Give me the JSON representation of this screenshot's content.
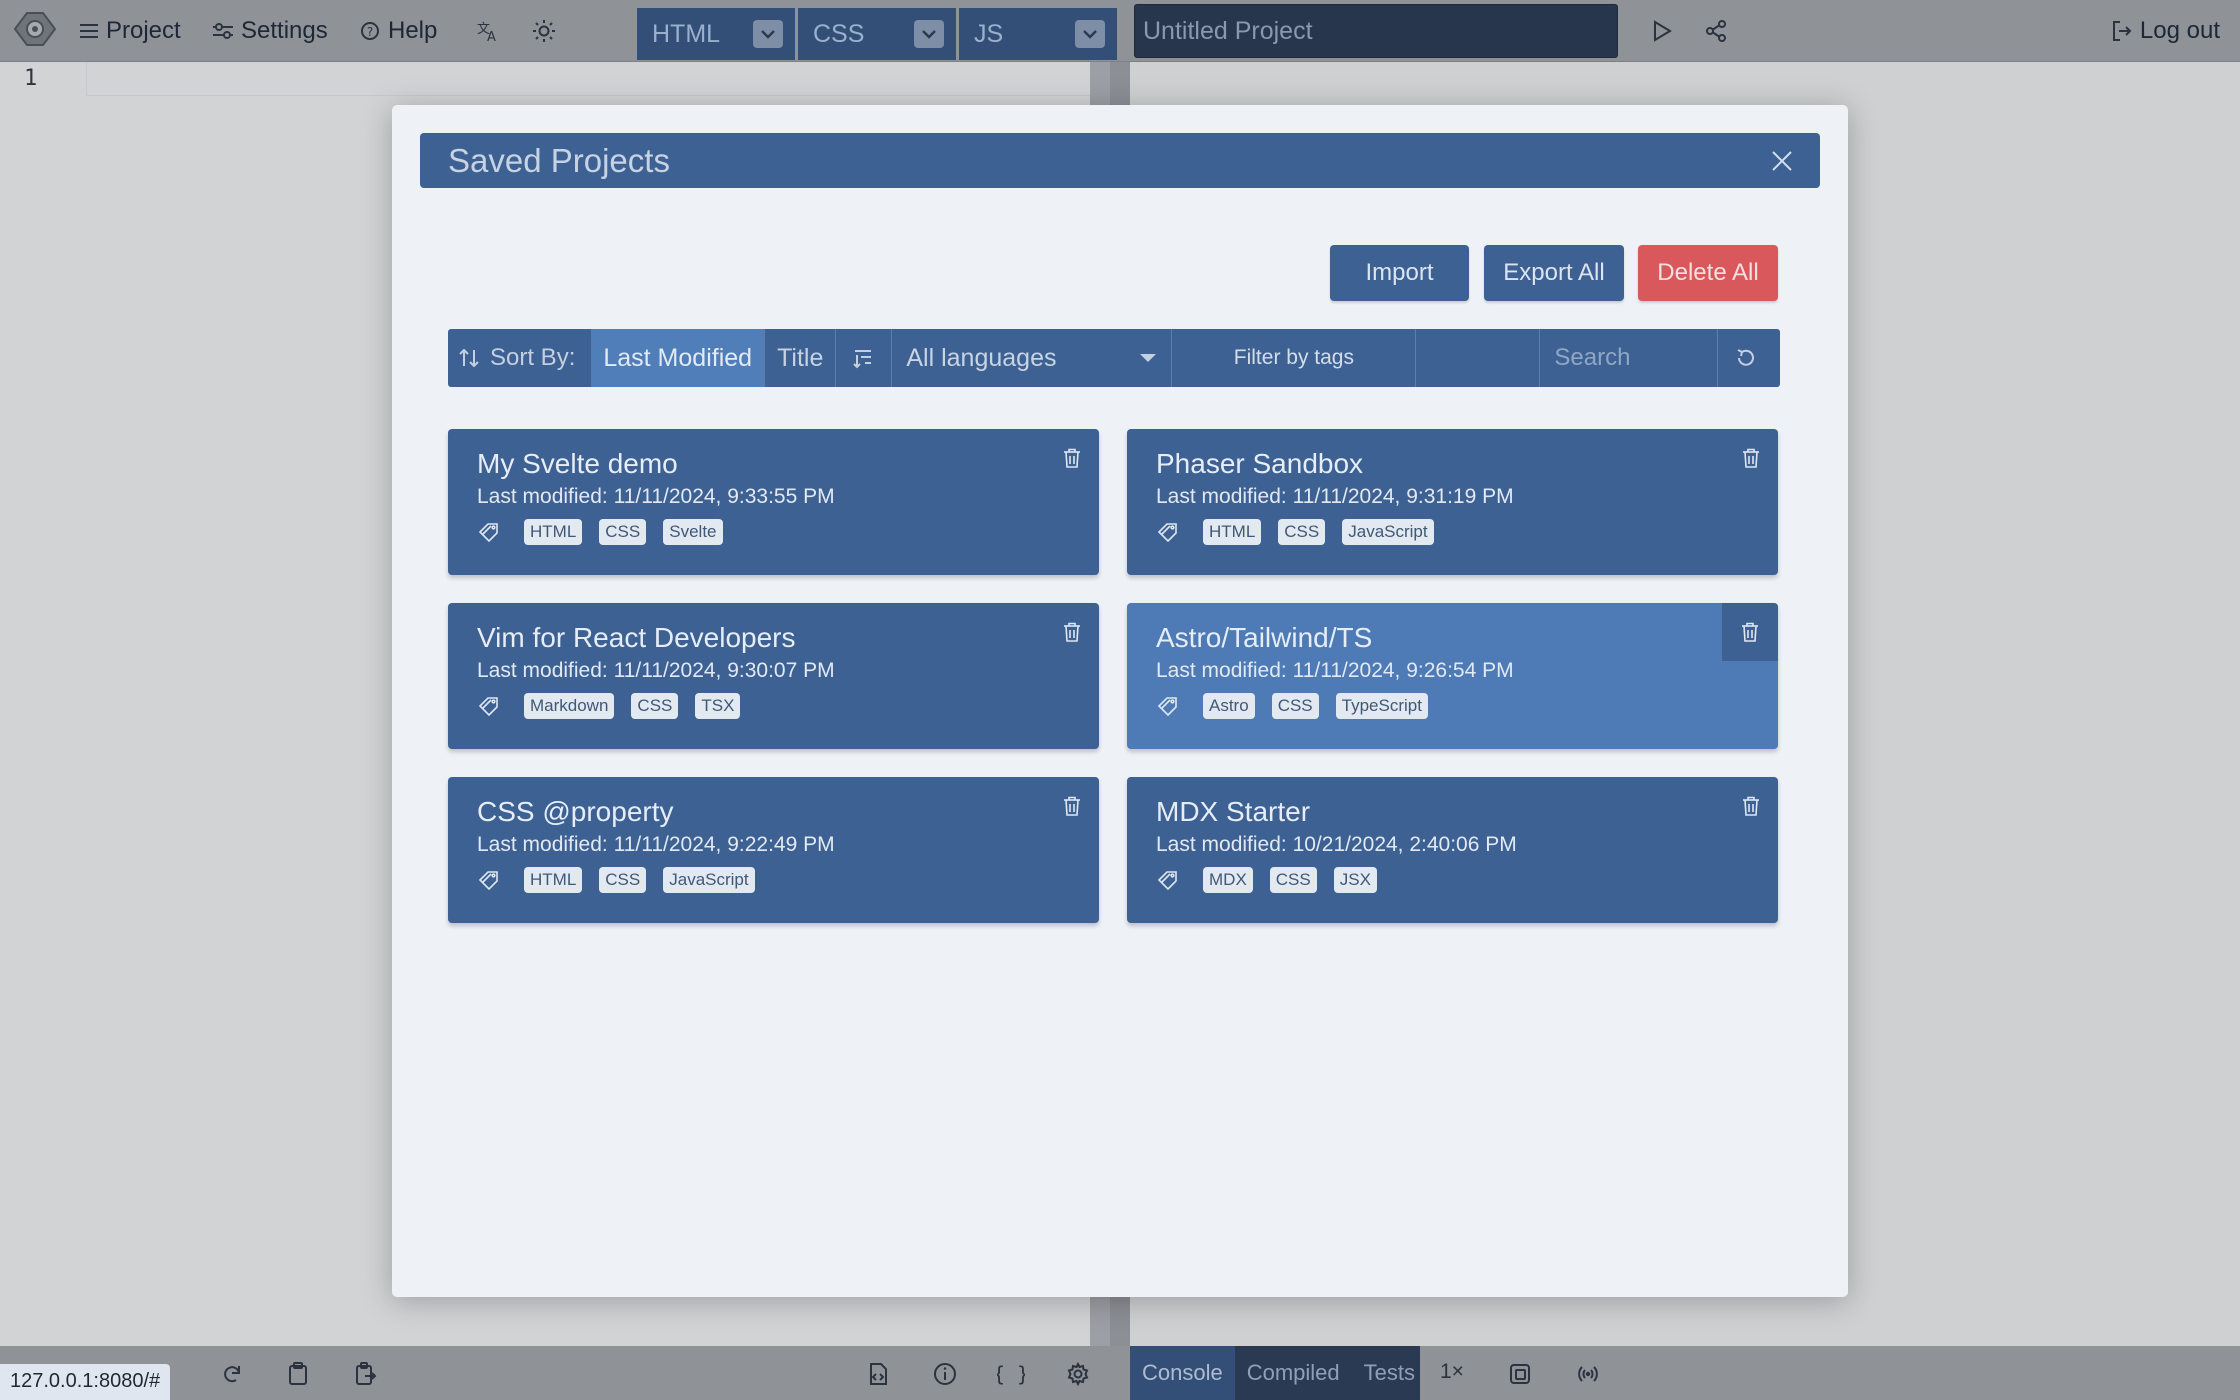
{
  "toolbar": {
    "project_label": "Project",
    "settings_label": "Settings",
    "help_label": "Help",
    "logout_label": "Log out",
    "project_title_placeholder": "Untitled Project"
  },
  "editor_tabs": [
    {
      "label": "HTML"
    },
    {
      "label": "CSS"
    },
    {
      "label": "JS"
    }
  ],
  "editor": {
    "line_number": "1"
  },
  "statusbar": {
    "url": "127.0.0.1:8080/#",
    "zoom": "1×"
  },
  "console_tabs": [
    {
      "label": "Console"
    },
    {
      "label": "Compiled"
    },
    {
      "label": "Tests"
    }
  ],
  "modal": {
    "title": "Saved Projects",
    "buttons": {
      "import": "Import",
      "export_all": "Export All",
      "delete_all": "Delete All"
    },
    "filters": {
      "sort_by_label": "Sort By:",
      "sort_options": [
        "Last Modified",
        "Title"
      ],
      "active_sort": "Last Modified",
      "language_select": "All languages",
      "tags_filter": "Filter by tags",
      "search_placeholder": "Search"
    },
    "projects": [
      {
        "title": "My Svelte demo",
        "modified": "Last modified: 11/11/2024, 9:33:55 PM",
        "tags": [
          "HTML",
          "CSS",
          "Svelte"
        ]
      },
      {
        "title": "Phaser Sandbox",
        "modified": "Last modified: 11/11/2024, 9:31:19 PM",
        "tags": [
          "HTML",
          "CSS",
          "JavaScript"
        ]
      },
      {
        "title": "Vim for React Developers",
        "modified": "Last modified: 11/11/2024, 9:30:07 PM",
        "tags": [
          "Markdown",
          "CSS",
          "TSX"
        ]
      },
      {
        "title": "Astro/Tailwind/TS",
        "modified": "Last modified: 11/11/2024, 9:26:54 PM",
        "tags": [
          "Astro",
          "CSS",
          "TypeScript"
        ]
      },
      {
        "title": "CSS @property",
        "modified": "Last modified: 11/11/2024, 9:22:49 PM",
        "tags": [
          "HTML",
          "CSS",
          "JavaScript"
        ]
      },
      {
        "title": "MDX Starter",
        "modified": "Last modified: 10/21/2024, 2:40:06 PM",
        "tags": [
          "MDX",
          "CSS",
          "JSX"
        ]
      }
    ]
  },
  "colors": {
    "accent": "#3d6193",
    "accent_hover": "#4e7bb5",
    "danger": "#d9585b",
    "modal_bg": "#eef2f6"
  }
}
